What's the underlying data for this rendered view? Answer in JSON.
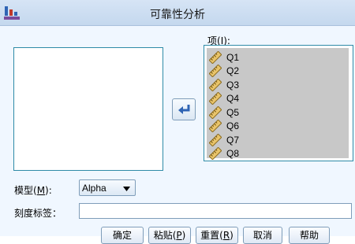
{
  "window": {
    "title": "可靠性分析"
  },
  "items_list": {
    "label_prefix": "项(",
    "label_key": "I",
    "label_suffix": "):",
    "items": [
      "Q1",
      "Q2",
      "Q3",
      "Q4",
      "Q5",
      "Q6",
      "Q7",
      "Q8"
    ],
    "item_icon": "ruler-icon",
    "selection_color": "#c8c8c8"
  },
  "model": {
    "label_prefix": "模型(",
    "label_key": "M",
    "label_suffix": "):",
    "value": "Alpha"
  },
  "scale_label": {
    "label": "刻度标签：",
    "value": ""
  },
  "buttons": {
    "ok": "确定",
    "paste_prefix": "粘贴(",
    "paste_key": "P",
    "paste_suffix": ")",
    "reset_prefix": "重置(",
    "reset_key": "R",
    "reset_suffix": ")",
    "cancel": "取消",
    "help": "帮助"
  },
  "colors": {
    "titlebar": "#c4d8ee",
    "client_bg": "#f0f7ff",
    "list_border": "#2e8ba8",
    "arrow": "#2f64b4"
  }
}
